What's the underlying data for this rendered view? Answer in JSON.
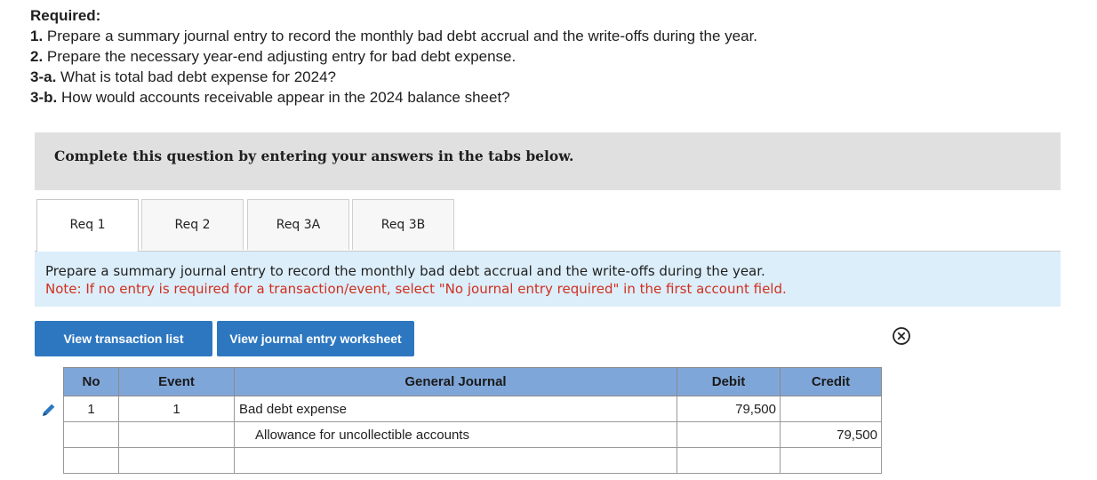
{
  "required": {
    "heading": "Required:",
    "items": [
      {
        "num": "1.",
        "text": " Prepare a summary journal entry to record the monthly bad debt accrual and the write-offs during the year."
      },
      {
        "num": "2.",
        "text": " Prepare the necessary year-end adjusting entry for bad debt expense."
      },
      {
        "num": "3-a.",
        "text": " What is total bad debt expense for 2024?"
      },
      {
        "num": "3-b.",
        "text": " How would accounts receivable appear in the 2024 balance sheet?"
      }
    ]
  },
  "instruction": "Complete this question by entering your answers in the tabs below.",
  "tabs": [
    {
      "label": "Req 1"
    },
    {
      "label": "Req 2"
    },
    {
      "label": "Req 3A"
    },
    {
      "label": "Req 3B"
    }
  ],
  "prompt": {
    "text": "Prepare a summary journal entry to record the monthly bad debt accrual and the write-offs during the year.",
    "note": "Note: If no entry is required for a transaction/event, select \"No journal entry required\" in the first account field."
  },
  "buttons": {
    "view_transactions": "View transaction list",
    "view_worksheet": "View journal entry worksheet"
  },
  "journal": {
    "headers": {
      "no": "No",
      "event": "Event",
      "general_journal": "General Journal",
      "debit": "Debit",
      "credit": "Credit"
    },
    "rows": [
      {
        "no": "1",
        "event": "1",
        "account": "Bad debt expense",
        "debit": "79,500",
        "credit": ""
      },
      {
        "no": "",
        "event": "",
        "account": "Allowance for uncollectible accounts",
        "debit": "",
        "credit": "79,500"
      },
      {
        "no": "",
        "event": "",
        "account": "",
        "debit": "",
        "credit": ""
      }
    ]
  },
  "colors": {
    "button_blue": "#2d77c1",
    "header_blue": "#7fa6d9",
    "note_red": "#d0301e",
    "prompt_bg": "#dceefa"
  },
  "icons": {
    "edit": "pencil-icon",
    "close": "close-circle-icon"
  }
}
